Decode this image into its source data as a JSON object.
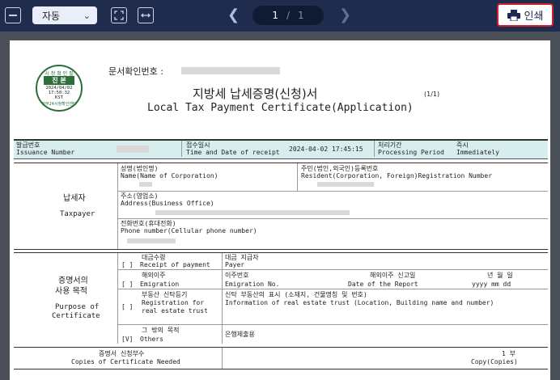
{
  "toolbar": {
    "zoom_value": "자동",
    "page_current": "1",
    "page_sep": "/",
    "page_total": "1",
    "print_label": "인쇄"
  },
  "doc": {
    "confirm_no_label": "문서확인번호 :",
    "stamp": {
      "line1": "시 청 확 인 필",
      "line2": "진 본",
      "date": "2024/04/02",
      "time": "17:50:32",
      "code": "KST",
      "bottom": "정부24시청확인센터"
    },
    "title_ko": "지방세 납세증명(신청)서",
    "title_en": "Local Tax Payment Certificate(Application)",
    "page_mark": "(1/1)",
    "issue_no_ko": "발급번호",
    "issue_no_en": "Issuance Number",
    "receipt_ko": "접수일시",
    "receipt_en": "Time and Date of receipt",
    "receipt_value": "2024-04-02 17:45:15",
    "period_ko": "처리기간",
    "period_en": "Processing Period",
    "period_value_ko": "즉시",
    "period_value_en": "Immediately",
    "taxpayer_ko": "납세자",
    "taxpayer_en": "Taxpayer",
    "name_ko": "성명(법인명)",
    "name_en": "Name(Name of Corporation)",
    "resident_ko": "주민(법인,외국인)등록번호",
    "resident_en": "Resident(Corporation, Foreign)Registration Number",
    "address_ko": "주소(영업소)",
    "address_en": "Address(Business Office)",
    "phone_ko": "전화번호(휴대전화)",
    "phone_en": "Phone number(Cellular phone number)",
    "purpose_ko1": "증명서의",
    "purpose_ko2": "사용 목적",
    "purpose_en1": "Purpose of",
    "purpose_en2": "Certificate",
    "p1_check": "[ ]",
    "p1_ko": "대금수령",
    "p1_en": "Receipt of payment",
    "p1_r_ko": "대금 지급자",
    "p1_r_en": "Payer",
    "p2_check": "[ ]",
    "p2_ko": "해외이주",
    "p2_en": "Emigration",
    "p2_r_ko": "이주번호",
    "p2_r_en": "Emigration No.",
    "p2_r2_ko": "해외이주 신고일",
    "p2_r2_en": "Date of the Report",
    "p2_date_ko": "년 월 일",
    "p2_date_en": "yyyy  mm  dd",
    "p3_check": "[ ]",
    "p3_ko": "부동산 신탁등기",
    "p3_en1": "Registration for",
    "p3_en2": "real estate trust",
    "p3_r_ko": "신탁 부동산의 표시 (소재지, 건물명칭 및 번호)",
    "p3_r_en": "Information of real estate trust (Location, Building name and number)",
    "p4_check": "[V]",
    "p4_ko": "그 밖의 목적",
    "p4_en": "Others",
    "p4_r": "은행제출용",
    "copies_ko": "증명서 신청부수",
    "copies_en": "Copies of Certificate Needed",
    "copies_val_ko": "1 부",
    "copies_val_en": "Copy(Copies)"
  }
}
